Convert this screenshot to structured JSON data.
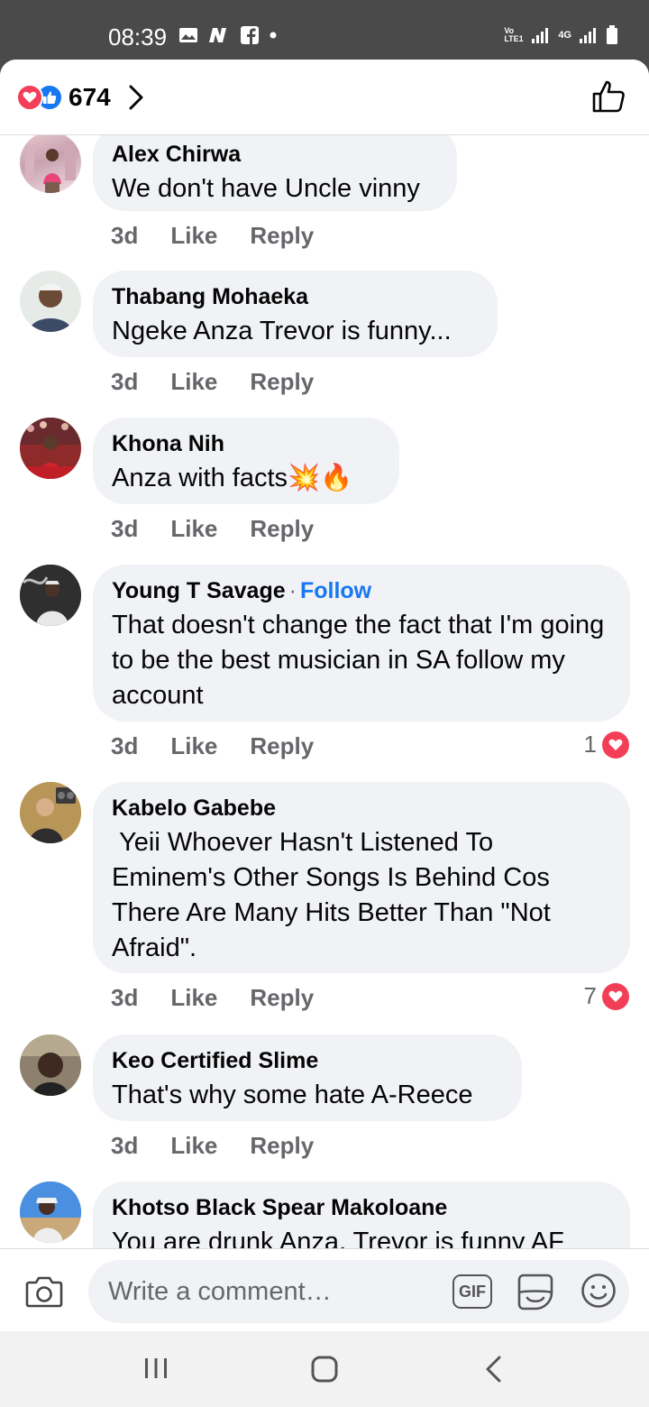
{
  "status_bar": {
    "time": "08:39",
    "network_labels": [
      "Vo LTE1",
      "4G"
    ]
  },
  "header": {
    "reaction_count": "674",
    "reaction_icons": [
      "love-icon",
      "like-icon"
    ]
  },
  "comments": [
    {
      "author": "Alex Chirwa",
      "text": "We don't have Uncle vinny",
      "time": "3d",
      "like": "Like",
      "reply": "Reply"
    },
    {
      "author": "Thabang Mohaeka",
      "text": "Ngeke Anza Trevor is funny...",
      "time": "3d",
      "like": "Like",
      "reply": "Reply"
    },
    {
      "author": "Khona Nih",
      "text": "Anza with facts💥🔥",
      "time": "3d",
      "like": "Like",
      "reply": "Reply"
    },
    {
      "author": "Young T Savage",
      "follow": "Follow",
      "text": "That doesn't change the fact that I'm going to be the best musician in SA follow my account",
      "time": "3d",
      "like": "Like",
      "reply": "Reply",
      "reactions": "1"
    },
    {
      "author": "Kabelo Gabebe",
      "text": " Yeii Whoever Hasn't Listened To Eminem's Other Songs Is Behind Cos There Are Many Hits Better Than \"Not Afraid\".",
      "time": "3d",
      "like": "Like",
      "reply": "Reply",
      "reactions": "7"
    },
    {
      "author": "Keo Certified Slime",
      "text": "That's why some hate A-Reece",
      "time": "3d",
      "like": "Like",
      "reply": "Reply"
    },
    {
      "author": "Khotso Black Spear Makoloane",
      "text": "You are drunk Anza, Trevor is funny AF"
    }
  ],
  "composer": {
    "placeholder": "Write a comment…",
    "gif_label": "GIF"
  },
  "colors": {
    "accent": "#1877f2",
    "love": "#f33e58",
    "bubble": "#f0f2f5",
    "secondary_text": "#65676b"
  }
}
